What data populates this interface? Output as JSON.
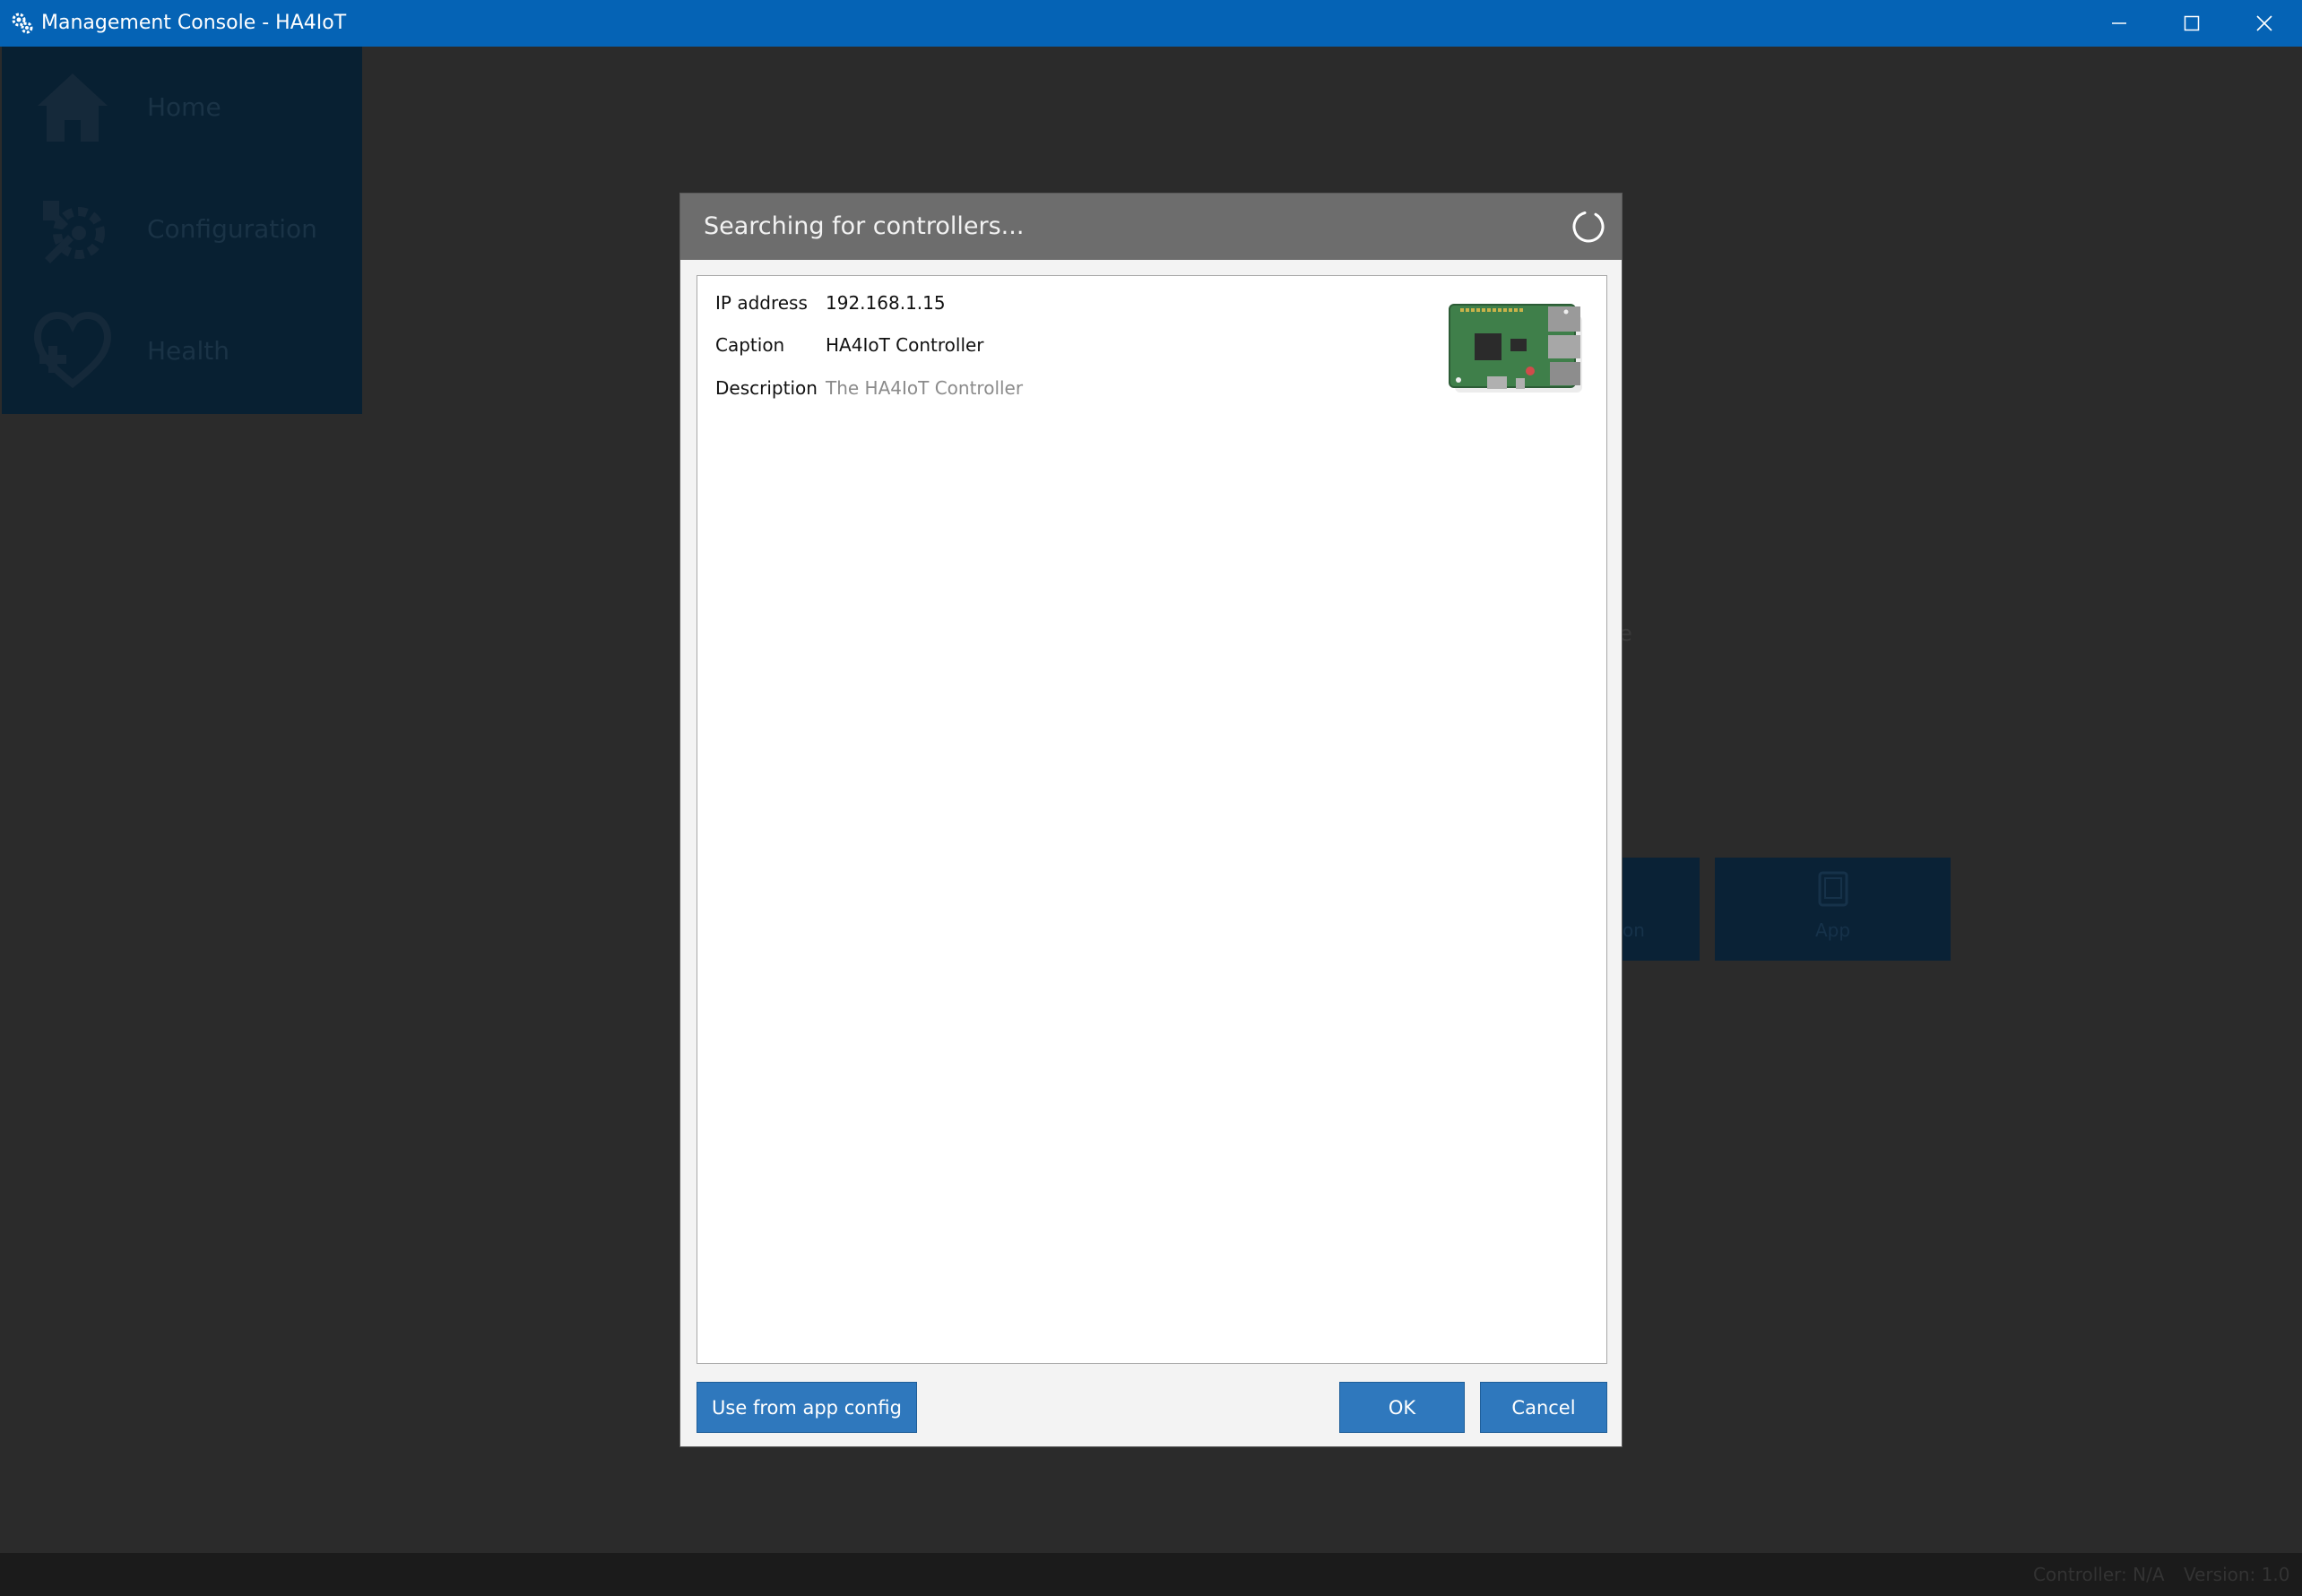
{
  "window": {
    "title": "Management Console - HA4IoT",
    "icon": "gears-icon",
    "controls": [
      "minimize-icon",
      "maximize-icon",
      "close-icon"
    ],
    "accent": "#0563b5"
  },
  "sidebar": {
    "items": [
      {
        "label": "Home",
        "icon": "house-icon"
      },
      {
        "label": "Configuration",
        "icon": "wrench-gear-icon"
      },
      {
        "label": "Health",
        "icon": "heart-plus-icon"
      }
    ]
  },
  "background": {
    "tiles": [
      {
        "label": "on"
      },
      {
        "label": "App",
        "icon": "tablet-icon"
      }
    ],
    "fragment_text": "e"
  },
  "statusbar": {
    "controller": "Controller: N/A",
    "version": "Version: 1.0"
  },
  "dialog": {
    "title": "Searching for controllers...",
    "spinner_icon": "loading-spinner-icon",
    "controller": {
      "ip_label": "IP address",
      "ip_value": "192.168.1.15",
      "caption_label": "Caption",
      "caption_value": "HA4IoT Controller",
      "description_label": "Description",
      "description_value": "The HA4IoT Controller",
      "image": "raspberry-pi-board-icon"
    },
    "buttons": {
      "use_app_config": "Use from app config",
      "ok": "OK",
      "cancel": "Cancel"
    },
    "button_color": "#2f78bd"
  }
}
